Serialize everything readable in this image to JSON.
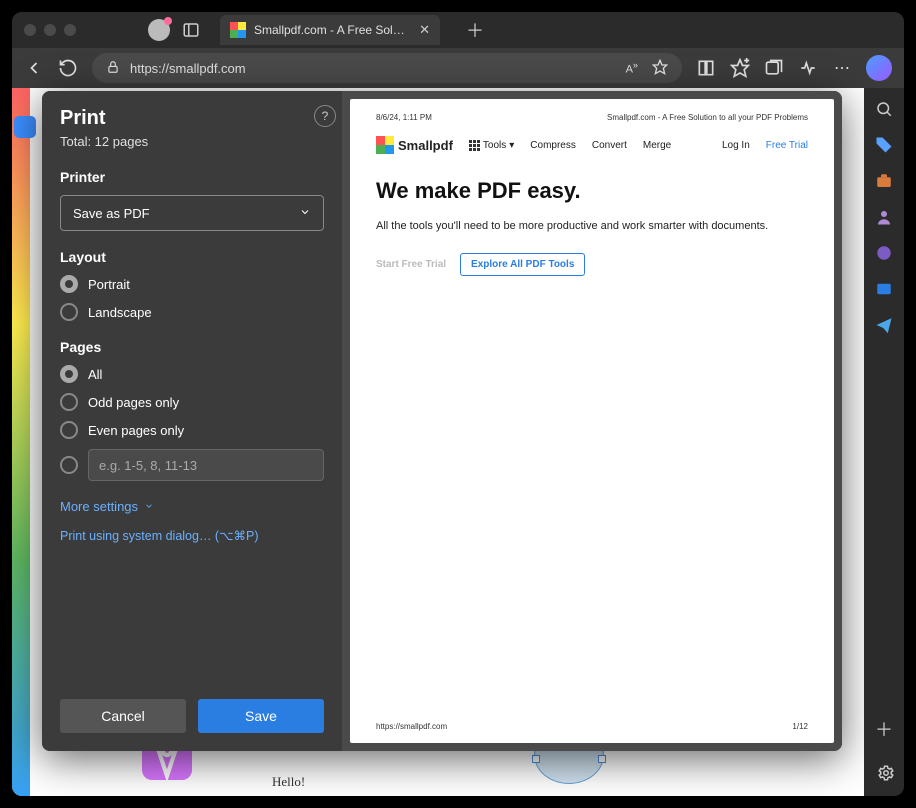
{
  "tab": {
    "title": "Smallpdf.com - A Free Solution"
  },
  "address": {
    "url": "https://smallpdf.com"
  },
  "print": {
    "title": "Print",
    "subtitle": "Total: 12 pages",
    "help": "?",
    "printer_label": "Printer",
    "printer_value": "Save as PDF",
    "layout_label": "Layout",
    "layout_portrait": "Portrait",
    "layout_landscape": "Landscape",
    "pages_label": "Pages",
    "pages_all": "All",
    "pages_odd": "Odd pages only",
    "pages_even": "Even pages only",
    "pages_placeholder": "e.g. 1-5, 8, 11-13",
    "more_settings": "More settings",
    "system_dialog": "Print using system dialog… (⌥⌘P)",
    "cancel": "Cancel",
    "save": "Save"
  },
  "preview": {
    "date": "8/6/24, 1:11 PM",
    "header": "Smallpdf.com - A Free Solution to all your PDF Problems",
    "brand": "Smallpdf",
    "tools": "Tools",
    "compress": "Compress",
    "convert": "Convert",
    "merge": "Merge",
    "login": "Log In",
    "free_trial": "Free Trial",
    "h1": "We make PDF easy.",
    "body": "All the tools you'll need to be more productive and work smarter with documents.",
    "start_trial": "Start Free Trial",
    "explore": "Explore All PDF Tools",
    "footer_url": "https://smallpdf.com",
    "footer_page": "1/12"
  },
  "deco": {
    "hello": "Hello!"
  }
}
